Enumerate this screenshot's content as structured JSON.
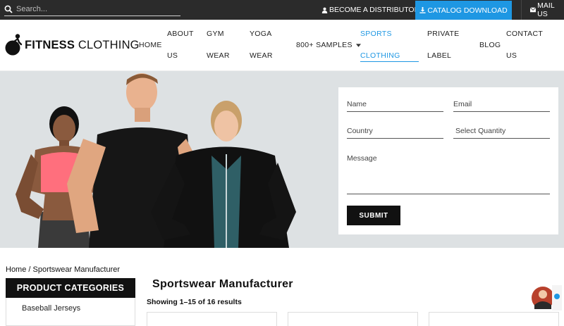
{
  "topbar": {
    "search_placeholder": "Search...",
    "distributor_label": "BECOME A DISTRIBUTOR",
    "catalog_label": "CATALOG DOWNLOAD",
    "mail_label": "MAIL US"
  },
  "logo": {
    "bold": "FITNESS",
    "regular": " CLOTHING"
  },
  "nav": {
    "home": "HOME",
    "about_1": "ABOUT",
    "about_2": "US",
    "gym_1": "GYM",
    "gym_2": "WEAR",
    "yoga_1": "YOGA",
    "yoga_2": "WEAR",
    "samples": "800+ SAMPLES",
    "sports_1": "SPORTS",
    "sports_2": "CLOTHING",
    "private_1": "PRIVATE",
    "private_2": "LABEL",
    "blog": "BLOG",
    "contact_1": "CONTACT",
    "contact_2": "US"
  },
  "form": {
    "name": "Name",
    "email": "Email",
    "country": "Country",
    "quantity": "Select Quantity",
    "message": "Message",
    "submit": "SUBMIT"
  },
  "breadcrumb": {
    "home": "Home",
    "separator": " / ",
    "current": "Sportswear Manufacturer"
  },
  "sidebar": {
    "title": "PRODUCT CATEGORIES",
    "items": [
      "Baseball Jerseys"
    ]
  },
  "main": {
    "title": "Sportswear Manufacturer",
    "results": "Showing 1–15 of 16 results"
  },
  "colors": {
    "accent": "#1e97e3",
    "topbar": "#2b2b2b",
    "hero_bg": "#dde1e3"
  },
  "icons": {
    "search": "search-icon",
    "user": "user-icon",
    "download": "download-icon",
    "mail": "mail-icon",
    "caret": "caret-down-icon"
  }
}
